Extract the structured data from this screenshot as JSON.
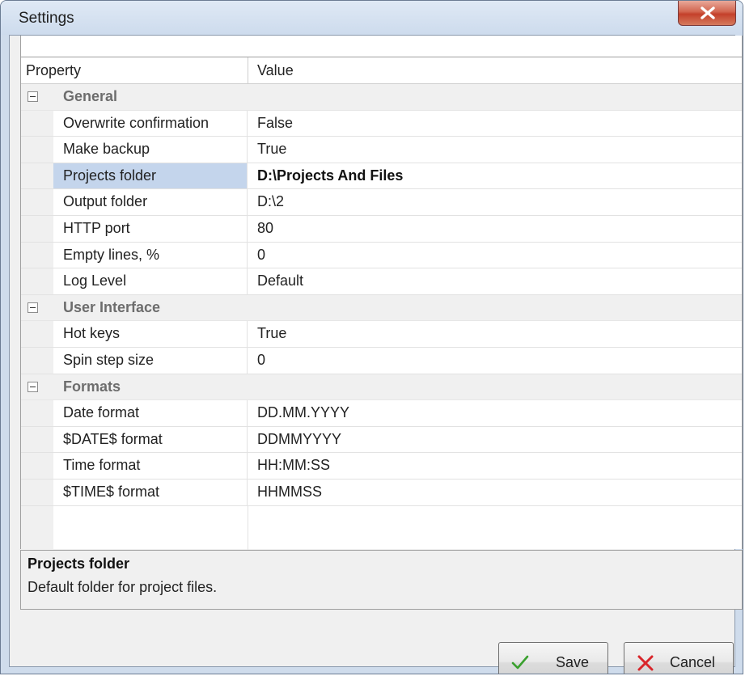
{
  "window": {
    "title": "Settings"
  },
  "grid": {
    "headers": {
      "property": "Property",
      "value": "Value"
    },
    "categories": [
      {
        "name": "General",
        "rows": [
          {
            "name": "Overwrite confirmation",
            "value": "False"
          },
          {
            "name": "Make backup",
            "value": "True"
          },
          {
            "name": "Projects folder",
            "value": "D:\\Projects And Files"
          },
          {
            "name": "Output folder",
            "value": "D:\\2"
          },
          {
            "name": "HTTP port",
            "value": "80"
          },
          {
            "name": "Empty lines, %",
            "value": "0"
          },
          {
            "name": "Log Level",
            "value": "Default"
          }
        ]
      },
      {
        "name": "User Interface",
        "rows": [
          {
            "name": "Hot keys",
            "value": "True"
          },
          {
            "name": "Spin step size",
            "value": "0"
          }
        ]
      },
      {
        "name": "Formats",
        "rows": [
          {
            "name": "Date format",
            "value": "DD.MM.YYYY"
          },
          {
            "name": "$DATE$ format",
            "value": "DDMMYYYY"
          },
          {
            "name": "Time format",
            "value": "HH:MM:SS"
          },
          {
            "name": "$TIME$ format",
            "value": "HHMMSS"
          }
        ]
      }
    ]
  },
  "help": {
    "title": "Projects folder",
    "description": "Default folder for project files."
  },
  "buttons": {
    "save_label": "Save",
    "cancel_label": "Cancel"
  },
  "colors": {
    "selection": "#c4d5ec",
    "save_check": "#3aa02e",
    "cancel_x": "#d9262b",
    "close_button": "#c4402a"
  },
  "icons": {
    "close": "close-icon",
    "collapse": "collapse-icon",
    "save": "checkmark-icon",
    "cancel": "cancel-x-icon"
  }
}
